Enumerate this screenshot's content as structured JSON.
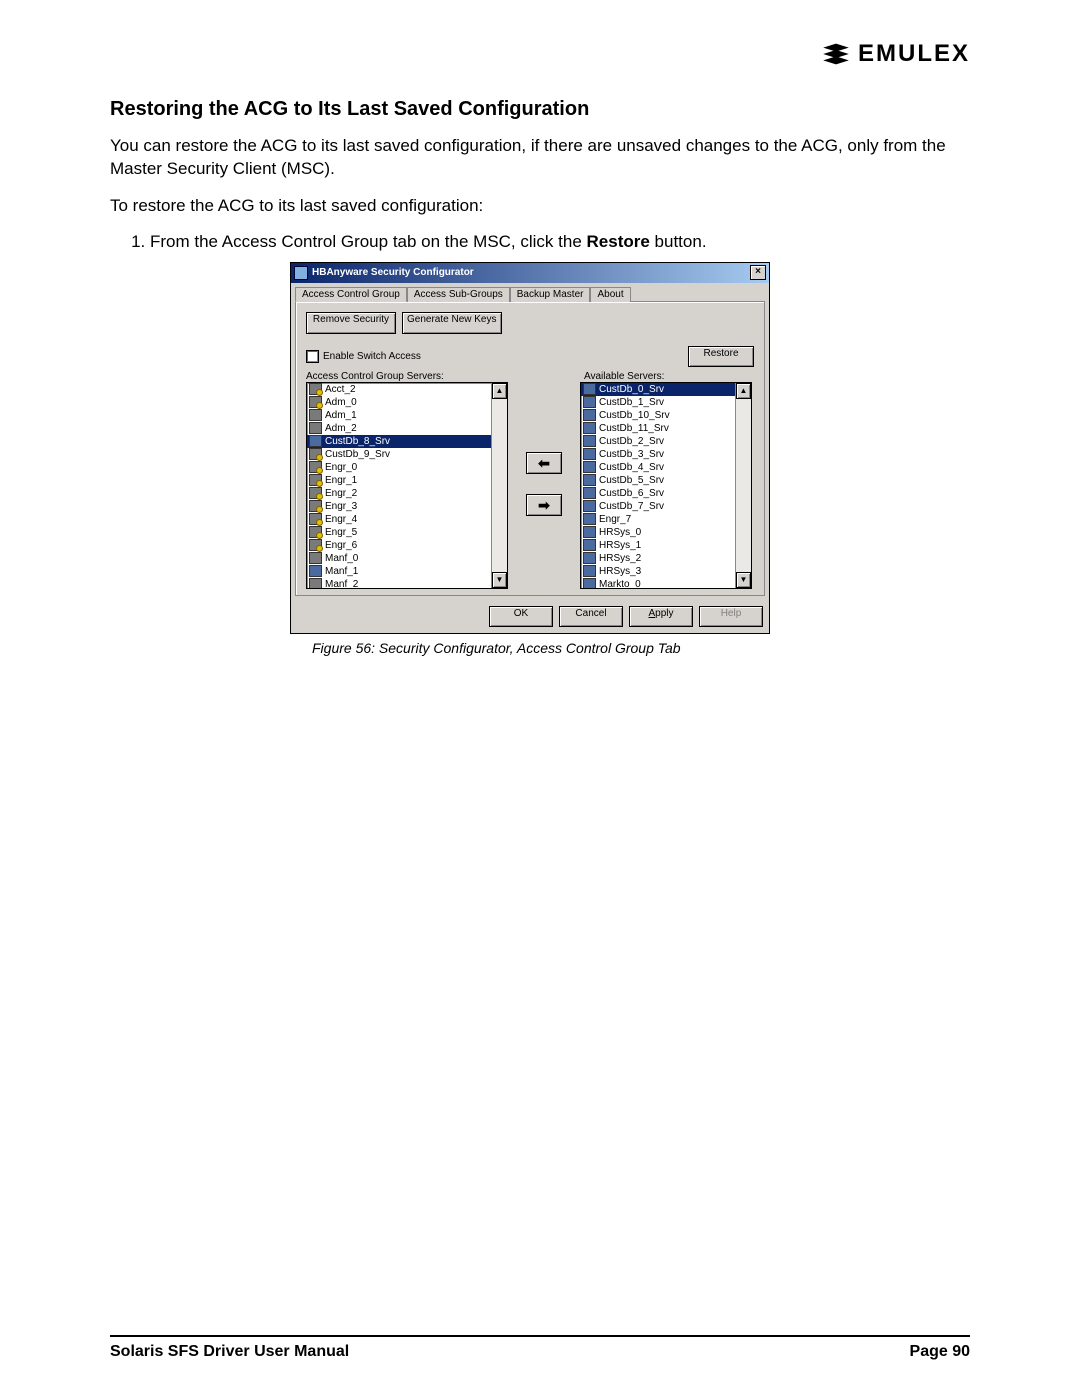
{
  "brand": {
    "name": "EMULEX"
  },
  "heading": "Restoring the ACG to Its Last Saved Configuration",
  "para1": "You can restore the ACG to its last saved configuration, if there are unsaved changes to the ACG, only from the Master Security Client (MSC).",
  "para2": "To restore the ACG to its last saved configuration:",
  "step1_pre": "From the Access Control Group tab on the MSC, click the ",
  "step1_bold": "Restore",
  "step1_post": " button.",
  "dialog": {
    "title": "HBAnyware Security Configurator",
    "tabs": {
      "t0": "Access Control Group",
      "t1": "Access Sub-Groups",
      "t2": "Backup Master",
      "t3": "About"
    },
    "buttons": {
      "remove_security": "Remove Security",
      "gen_keys": "Generate New Keys",
      "restore": "Restore",
      "ok": "OK",
      "cancel": "Cancel",
      "apply": "Apply",
      "help": "Help"
    },
    "enable_switch": "Enable Switch Access",
    "labels": {
      "acg_servers": "Access Control Group Servers:",
      "avail_servers": "Available Servers:"
    },
    "acg_list": {
      "i0": "Acct_2",
      "i1": "Adm_0",
      "i2": "Adm_1",
      "i3": "Adm_2",
      "i4": "CustDb_8_Srv",
      "i5": "CustDb_9_Srv",
      "i6": "Engr_0",
      "i7": "Engr_1",
      "i8": "Engr_2",
      "i9": "Engr_3",
      "i10": "Engr_4",
      "i11": "Engr_5",
      "i12": "Engr_6",
      "i13": "Manf_0",
      "i14": "Manf_1",
      "i15": "Manf_2"
    },
    "avail_list": {
      "i0": "CustDb_0_Srv",
      "i1": "CustDb_1_Srv",
      "i2": "CustDb_10_Srv",
      "i3": "CustDb_11_Srv",
      "i4": "CustDb_2_Srv",
      "i5": "CustDb_3_Srv",
      "i6": "CustDb_4_Srv",
      "i7": "CustDb_5_Srv",
      "i8": "CustDb_6_Srv",
      "i9": "CustDb_7_Srv",
      "i10": "Engr_7",
      "i11": "HRSys_0",
      "i12": "HRSys_1",
      "i13": "HRSys_2",
      "i14": "HRSys_3",
      "i15": "Markto_0"
    }
  },
  "figcaption": "Figure 56: Security Configurator, Access Control Group Tab",
  "footer": {
    "left": "Solaris SFS Driver User Manual",
    "right": "Page 90"
  }
}
